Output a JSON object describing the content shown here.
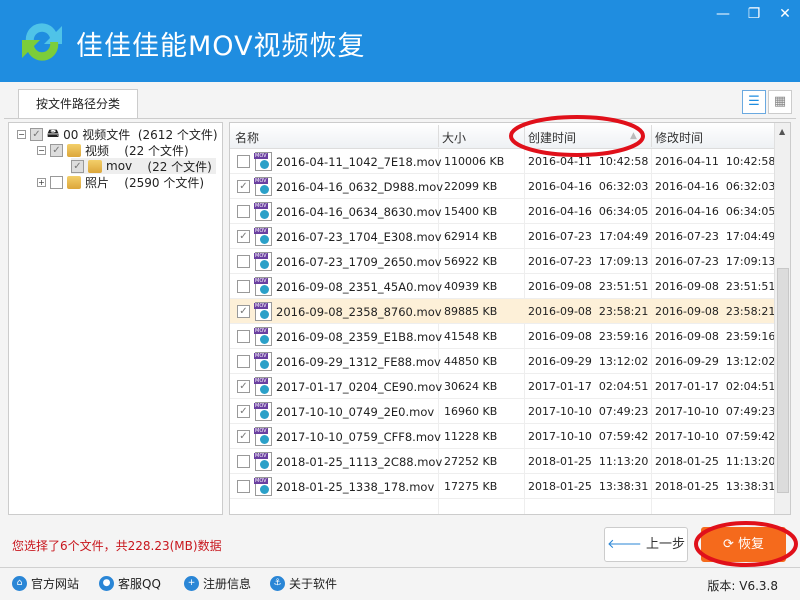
{
  "window": {
    "title": "佳佳佳能MOV视频恢复",
    "min": "—",
    "max": "❐",
    "close": "✕"
  },
  "tab": "按文件路径分类",
  "tree": [
    {
      "label": "00 视频文件",
      "count": "(2612 个文件)",
      "checked": "partial"
    },
    {
      "label": "视频",
      "count": "(22 个文件)",
      "checked": "partial"
    },
    {
      "label": "mov",
      "count": "(22 个文件)",
      "checked": "partial"
    },
    {
      "label": "照片",
      "count": "(2590 个文件)",
      "checked": "no"
    }
  ],
  "columns": [
    "名称",
    "大小",
    "创建时间",
    "修改时间"
  ],
  "sort": {
    "column": "创建时间",
    "direction": "ascending"
  },
  "files": [
    {
      "name": "2016-04-11_1042_7E18.mov",
      "size": "110006 KB",
      "created": "2016-04-11  10:42:58",
      "modified": "2016-04-11  10:42:58",
      "checked": false
    },
    {
      "name": "2016-04-16_0632_D988.mov",
      "size": "22099 KB",
      "created": "2016-04-16  06:32:03",
      "modified": "2016-04-16  06:32:03",
      "checked": true
    },
    {
      "name": "2016-04-16_0634_8630.mov",
      "size": "15400 KB",
      "created": "2016-04-16  06:34:05",
      "modified": "2016-04-16  06:34:05",
      "checked": false
    },
    {
      "name": "2016-07-23_1704_E308.mov",
      "size": "62914 KB",
      "created": "2016-07-23  17:04:49",
      "modified": "2016-07-23  17:04:49",
      "checked": true
    },
    {
      "name": "2016-07-23_1709_2650.mov",
      "size": "56922 KB",
      "created": "2016-07-23  17:09:13",
      "modified": "2016-07-23  17:09:13",
      "checked": false
    },
    {
      "name": "2016-09-08_2351_45A0.mov",
      "size": "40939 KB",
      "created": "2016-09-08  23:51:51",
      "modified": "2016-09-08  23:51:51",
      "checked": false
    },
    {
      "name": "2016-09-08_2358_8760.mov",
      "size": "89885 KB",
      "created": "2016-09-08  23:58:21",
      "modified": "2016-09-08  23:58:21",
      "checked": true,
      "selected": true
    },
    {
      "name": "2016-09-08_2359_E1B8.mov",
      "size": "41548 KB",
      "created": "2016-09-08  23:59:16",
      "modified": "2016-09-08  23:59:16",
      "checked": false
    },
    {
      "name": "2016-09-29_1312_FE88.mov",
      "size": "44850 KB",
      "created": "2016-09-29  13:12:02",
      "modified": "2016-09-29  13:12:02",
      "checked": false
    },
    {
      "name": "2017-01-17_0204_CE90.mov",
      "size": "30624 KB",
      "created": "2017-01-17  02:04:51",
      "modified": "2017-01-17  02:04:51",
      "checked": true
    },
    {
      "name": "2017-10-10_0749_2E0.mov",
      "size": "16960 KB",
      "created": "2017-10-10  07:49:23",
      "modified": "2017-10-10  07:49:23",
      "checked": true
    },
    {
      "name": "2017-10-10_0759_CFF8.mov",
      "size": "11228 KB",
      "created": "2017-10-10  07:59:42",
      "modified": "2017-10-10  07:59:42",
      "checked": true
    },
    {
      "name": "2018-01-25_1113_2C88.mov",
      "size": "27252 KB",
      "created": "2018-01-25  11:13:20",
      "modified": "2018-01-25  11:13:20",
      "checked": false
    },
    {
      "name": "2018-01-25_1338_178.mov",
      "size": "17275 KB",
      "created": "2018-01-25  13:38:31",
      "modified": "2018-01-25  13:38:31",
      "checked": false
    }
  ],
  "status": "您选择了6个文件，共228.23(MB)数据",
  "buttons": {
    "back": "上一步",
    "recover": "恢复"
  },
  "footer": [
    {
      "label": "官方网站",
      "icon": "home-icon"
    },
    {
      "label": "客服QQ",
      "icon": "qq-icon"
    },
    {
      "label": "注册信息",
      "icon": "user-add-icon"
    },
    {
      "label": "关于软件",
      "icon": "info-icon"
    }
  ],
  "version": "版本: V6.3.8",
  "colors": {
    "titlebar": "#1f8de0",
    "recover": "#f56a1c",
    "status": "#c8161d",
    "annotation": "#e0101a"
  }
}
